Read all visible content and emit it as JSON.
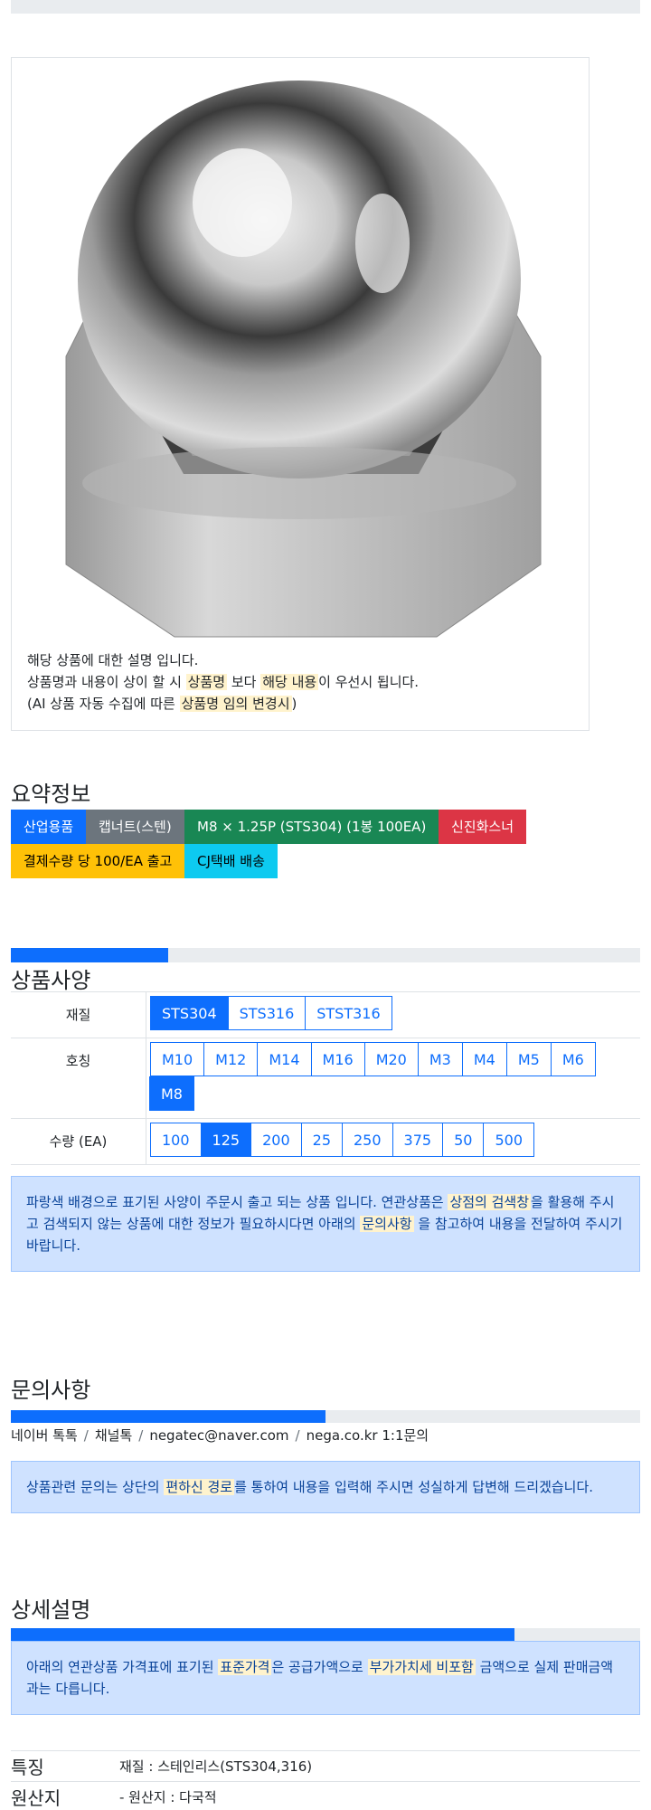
{
  "product_image": {
    "desc_line1": "해당 상품에 대한 설명 입니다.",
    "desc_line2": [
      {
        "t": "상품명과 내용이 상이 할 시 ",
        "h": false
      },
      {
        "t": "상품명",
        "h": true
      },
      {
        "t": " 보다 ",
        "h": false
      },
      {
        "t": "해당 내용",
        "h": true
      },
      {
        "t": "이 우선시 됩니다.",
        "h": false
      }
    ],
    "desc_line3": [
      {
        "t": "(AI 상품 자동 수집에 따른 ",
        "h": false
      },
      {
        "t": "상품명 임의 변경시",
        "h": true
      },
      {
        "t": ")",
        "h": false
      }
    ]
  },
  "summary": {
    "title": "요약정보",
    "badges": [
      {
        "label": "산업용품",
        "color": "#0d6efd",
        "text": "#ffffff"
      },
      {
        "label": "캡너트(스텐)",
        "color": "#6c757d",
        "text": "#ffffff"
      },
      {
        "label": "M8 × 1.25P (STS304) (1봉 100EA)",
        "color": "#198754",
        "text": "#ffffff"
      },
      {
        "label": "신진화스너",
        "color": "#dc3545",
        "text": "#ffffff"
      },
      {
        "label": "결제수량 당 100/EA 출고",
        "color": "#ffc107",
        "text": "#000000"
      },
      {
        "label": "CJ택배 배송",
        "color": "#0dcaf0",
        "text": "#000000"
      }
    ]
  },
  "spec": {
    "title": "상품사양",
    "progress": 0.25,
    "rows": [
      {
        "label": "재질",
        "options": [
          "STS304",
          "STS316",
          "STST316"
        ],
        "selected": "STS304"
      },
      {
        "label": "호칭",
        "options": [
          "M10",
          "M12",
          "M14",
          "M16",
          "M20",
          "M3",
          "M4",
          "M5",
          "M6",
          "M8"
        ],
        "selected": "M8"
      },
      {
        "label": "수량 (EA)",
        "options": [
          "100",
          "125",
          "200",
          "25",
          "250",
          "375",
          "50",
          "500"
        ],
        "selected": "125"
      }
    ],
    "notice": [
      {
        "t": "파랑색 배경으로 표기된 사양이 주문시 출고 되는 상품 입니다. 연관상품은 ",
        "h": false
      },
      {
        "t": "상점의 검색창",
        "h": true
      },
      {
        "t": "을 활용해 주시고 검색되지 않는 상품에 대한 정보가 필요하시다면 아래의 ",
        "h": false
      },
      {
        "t": "문의사항",
        "h": true
      },
      {
        "t": " 을 참고하여 내용을 전달하여 주시기 바랍니다.",
        "h": false
      }
    ]
  },
  "inquiry": {
    "title": "문의사항",
    "progress": 0.5,
    "links": [
      "네이버 톡톡",
      "채널톡",
      "negatec@naver.com",
      "nega.co.kr 1:1문의"
    ],
    "notice": [
      {
        "t": "상품관련 문의는 상단의 ",
        "h": false
      },
      {
        "t": "편하신 경로",
        "h": true
      },
      {
        "t": "를 통하여 내용을 입력해 주시면 성실하게 답변해 드리겠습니다.",
        "h": false
      }
    ]
  },
  "detail": {
    "title": "상세설명",
    "progress": 0.8,
    "notice": [
      {
        "t": "아래의 연관상품 가격표에 표기된 ",
        "h": false
      },
      {
        "t": "표준가격",
        "h": true
      },
      {
        "t": "은 공급가액으로 ",
        "h": false
      },
      {
        "t": "부가가치세 비포함",
        "h": true
      },
      {
        "t": " 금액으로 실제 판매금액과는 다릅니다.",
        "h": false
      }
    ],
    "features": [
      {
        "key": "특징",
        "value": "재질 : 스테인리스(STS304,316)"
      },
      {
        "key": "원산지",
        "value": "- 원산지 : 다국적"
      }
    ]
  }
}
